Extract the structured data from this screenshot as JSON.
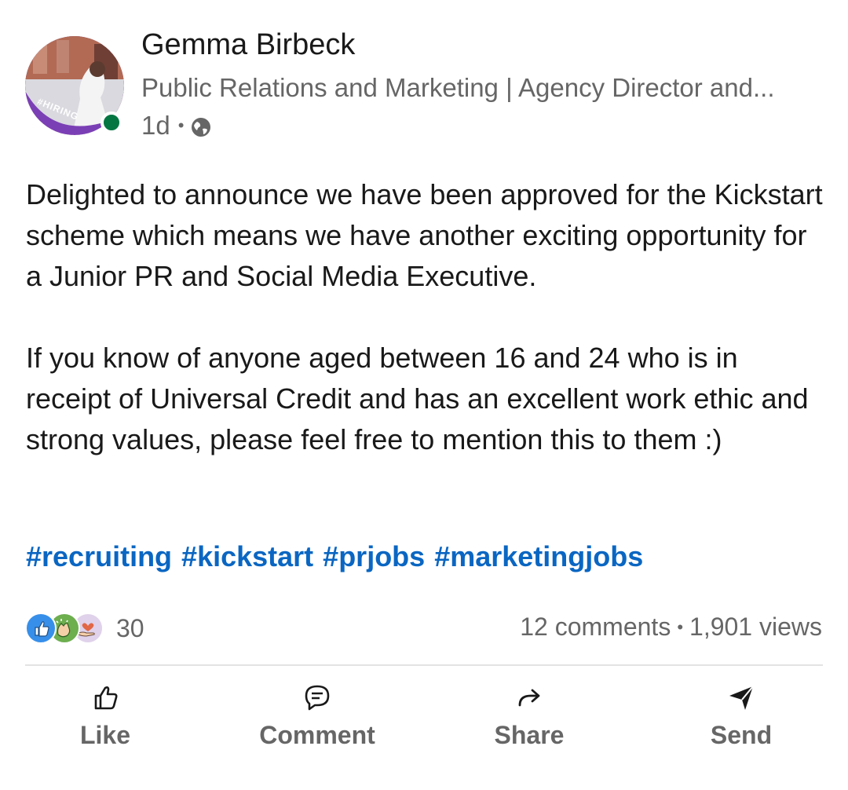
{
  "post": {
    "author": {
      "name": "Gemma Birbeck",
      "headline": "Public Relations and Marketing | Agency Director and...",
      "avatar_badge": "#HIRING",
      "presence_color": "#057642"
    },
    "time_ago": "1d",
    "visibility_icon": "globe-icon",
    "body_paragraphs": [
      "Delighted to announce we have been approved for the Kickstart scheme which means we have another exciting opportunity for a Junior PR and Social Media Executive.",
      "If you know of anyone aged between 16 and 24 who is in receipt of Universal Credit and has an excellent work ethic and strong values, please feel free to mention this to them :)"
    ],
    "hashtags": [
      "#recruiting",
      "#kickstart",
      "#prjobs",
      "#marketingjobs"
    ],
    "hashtag_color": "#0a66c2"
  },
  "social": {
    "reaction_icons": [
      "like-reaction-icon",
      "celebrate-reaction-icon",
      "support-reaction-icon"
    ],
    "reaction_count": "30",
    "comments": "12 comments",
    "separator": "•",
    "views": "1,901 views"
  },
  "actions": {
    "like": {
      "label": "Like",
      "icon": "thumbs-up-icon"
    },
    "comment": {
      "label": "Comment",
      "icon": "comment-icon"
    },
    "share": {
      "label": "Share",
      "icon": "share-arrow-icon"
    },
    "send": {
      "label": "Send",
      "icon": "send-icon"
    }
  }
}
